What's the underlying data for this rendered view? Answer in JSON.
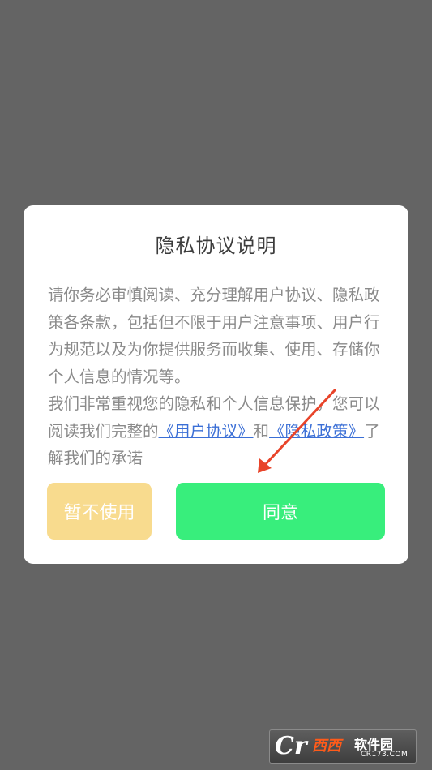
{
  "dialog": {
    "title": "隐私协议说明",
    "paragraph1": "请你务必审慎阅读、充分理解用户协议、隐私政策各条款，包括但不限于用户注意事项、用户行为规范以及为你提供服务而收集、使用、存储你个人信息的情况等。",
    "paragraph2_prefix": "我们非常重视您的隐私和个人信息保护，您可以阅读我们完整的",
    "user_agreement_link": "《用户协议》",
    "conjunction": "和",
    "privacy_policy_link": "《隐私政策》",
    "paragraph2_suffix": "了解我们的承诺",
    "decline_label": "暂不使用",
    "agree_label": "同意"
  },
  "annotation": {
    "arrow_color": "#e8442a"
  },
  "watermark": {
    "logo": "Cr",
    "brand": "西西",
    "name": "软件园",
    "url": "CR173.COM"
  }
}
